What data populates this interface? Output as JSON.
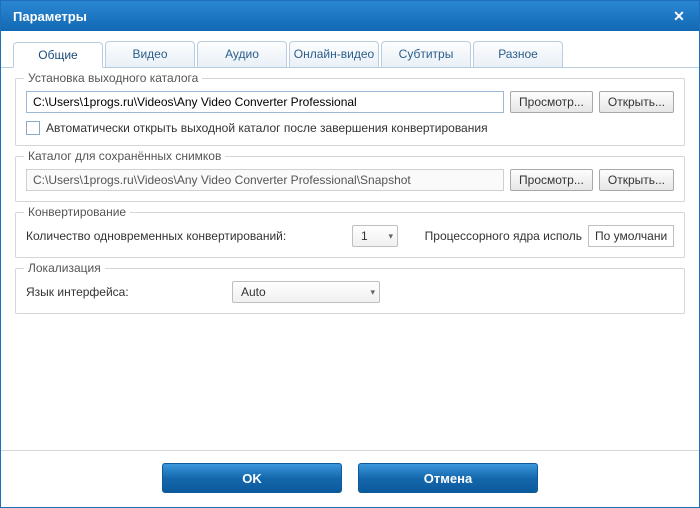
{
  "window": {
    "title": "Параметры"
  },
  "tabs": {
    "general": "Общие",
    "video": "Видео",
    "audio": "Аудио",
    "online": "Онлайн-видео",
    "subtitles": "Субтитры",
    "misc": "Разное"
  },
  "output_group": {
    "legend": "Установка выходного каталога",
    "path": "C:\\Users\\1progs.ru\\Videos\\Any Video Converter Professional",
    "browse": "Просмотр...",
    "open": "Открыть...",
    "auto_open": "Автоматически открыть выходной каталог после завершения конвертирования"
  },
  "snapshot_group": {
    "legend": "Каталог для сохранённых снимков",
    "path": "C:\\Users\\1progs.ru\\Videos\\Any Video Converter Professional\\Snapshot",
    "browse": "Просмотр...",
    "open": "Открыть..."
  },
  "convert_group": {
    "legend": "Конвертирование",
    "simul_label": "Количество одновременных конвертирований:",
    "simul_value": "1",
    "cpu_label": "Процессорного ядра исполь",
    "cpu_value": "По умолчани"
  },
  "locale_group": {
    "legend": "Локализация",
    "lang_label": "Язык интерфейса:",
    "lang_value": "Auto"
  },
  "footer": {
    "ok": "OK",
    "cancel": "Отмена"
  }
}
